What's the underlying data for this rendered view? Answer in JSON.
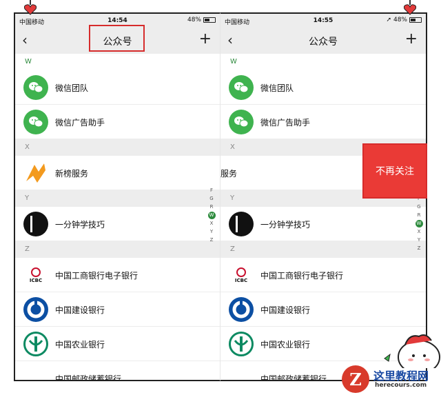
{
  "colors": {
    "wechat_green": "#3fb34f",
    "unfollow_red": "#ea3a36",
    "annotation_red": "#d62b2b",
    "header_bg": "#ededed"
  },
  "left": {
    "status": {
      "carrier": "中国移动",
      "time": "14:54",
      "battery": "48%"
    },
    "nav": {
      "back_icon": "chevron-left-icon",
      "title": "公众号",
      "add_icon": "plus-icon"
    },
    "sections": [
      "W",
      "X",
      "Y",
      "Z"
    ],
    "rows": [
      {
        "name": "微信团队",
        "icon": "wechat-icon"
      },
      {
        "name": "微信广告助手",
        "icon": "wechat-icon"
      },
      {
        "name": "新榜服务",
        "icon": "xinbang-logo"
      },
      {
        "name": "一分钟学技巧",
        "icon": "yifen-logo"
      },
      {
        "name": "中国工商银行电子银行",
        "icon": "icbc-logo"
      },
      {
        "name": "中国建设银行",
        "icon": "ccb-logo"
      },
      {
        "name": "中国农业银行",
        "icon": "abc-logo"
      },
      {
        "name": "中国邮政储蓄银行",
        "icon": "psbc-logo"
      }
    ],
    "index": [
      "F",
      "G",
      "R",
      "W",
      "X",
      "Y",
      "Z"
    ]
  },
  "right": {
    "status": {
      "carrier": "中国移动",
      "time": "14:55",
      "battery": "48%"
    },
    "nav": {
      "title": "公众号"
    },
    "swiped_row_partial": "服务",
    "action": "不再关注"
  },
  "annotation": {
    "icbc_text": "ICBC"
  },
  "watermark": {
    "logo": "Z",
    "title": "这里教程网",
    "url": "herecours.com"
  }
}
